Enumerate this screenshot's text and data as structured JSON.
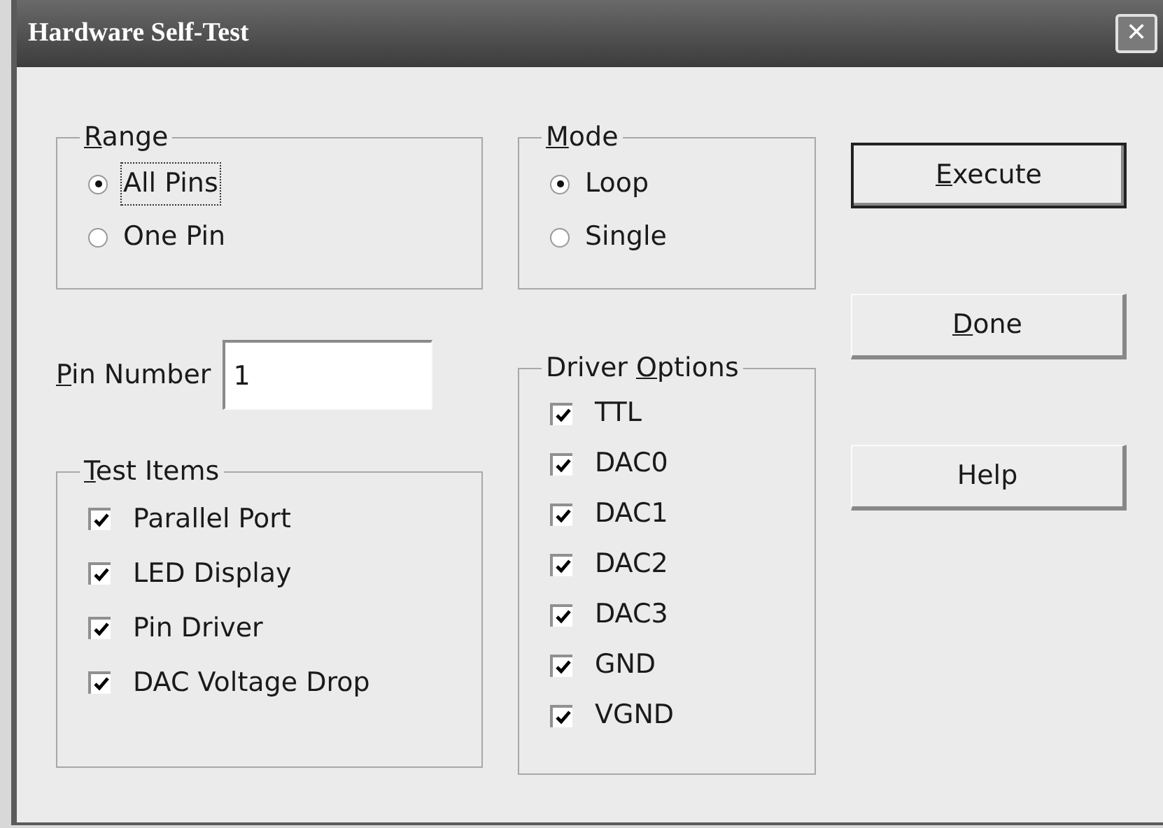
{
  "window": {
    "title": "Hardware Self-Test",
    "close_button": "✕"
  },
  "range": {
    "label": {
      "key": "R",
      "after": "ange"
    },
    "options": [
      {
        "label": "All Pins",
        "selected": true,
        "focused": true
      },
      {
        "label": "One Pin",
        "selected": false,
        "focused": false
      }
    ]
  },
  "pin_number": {
    "label": {
      "key": "P",
      "after": "in Number"
    },
    "value": "1"
  },
  "test_items": {
    "label": {
      "key": "T",
      "after": "est Items"
    },
    "items": [
      {
        "label": "Parallel Port",
        "checked": true
      },
      {
        "label": "LED Display",
        "checked": true
      },
      {
        "label": "Pin Driver",
        "checked": true
      },
      {
        "label": "DAC Voltage Drop",
        "checked": true
      }
    ]
  },
  "mode": {
    "label": {
      "key": "M",
      "after": "ode"
    },
    "options": [
      {
        "label": "Loop",
        "selected": true,
        "focused": false
      },
      {
        "label": "Single",
        "selected": false,
        "focused": false
      }
    ]
  },
  "driver_options": {
    "label": {
      "before": "Driver ",
      "key": "O",
      "after": "ptions"
    },
    "items": [
      {
        "label": "TTL",
        "checked": true
      },
      {
        "label": "DAC0",
        "checked": true
      },
      {
        "label": "DAC1",
        "checked": true
      },
      {
        "label": "DAC2",
        "checked": true
      },
      {
        "label": "DAC3",
        "checked": true
      },
      {
        "label": "GND",
        "checked": true
      },
      {
        "label": "VGND",
        "checked": true
      }
    ]
  },
  "buttons": [
    {
      "label": {
        "key": "E",
        "after": "xecute"
      },
      "default": true
    },
    {
      "label": {
        "key": "D",
        "after": "one"
      },
      "default": false
    },
    {
      "label": {
        "before": "Help"
      },
      "default": false
    }
  ]
}
